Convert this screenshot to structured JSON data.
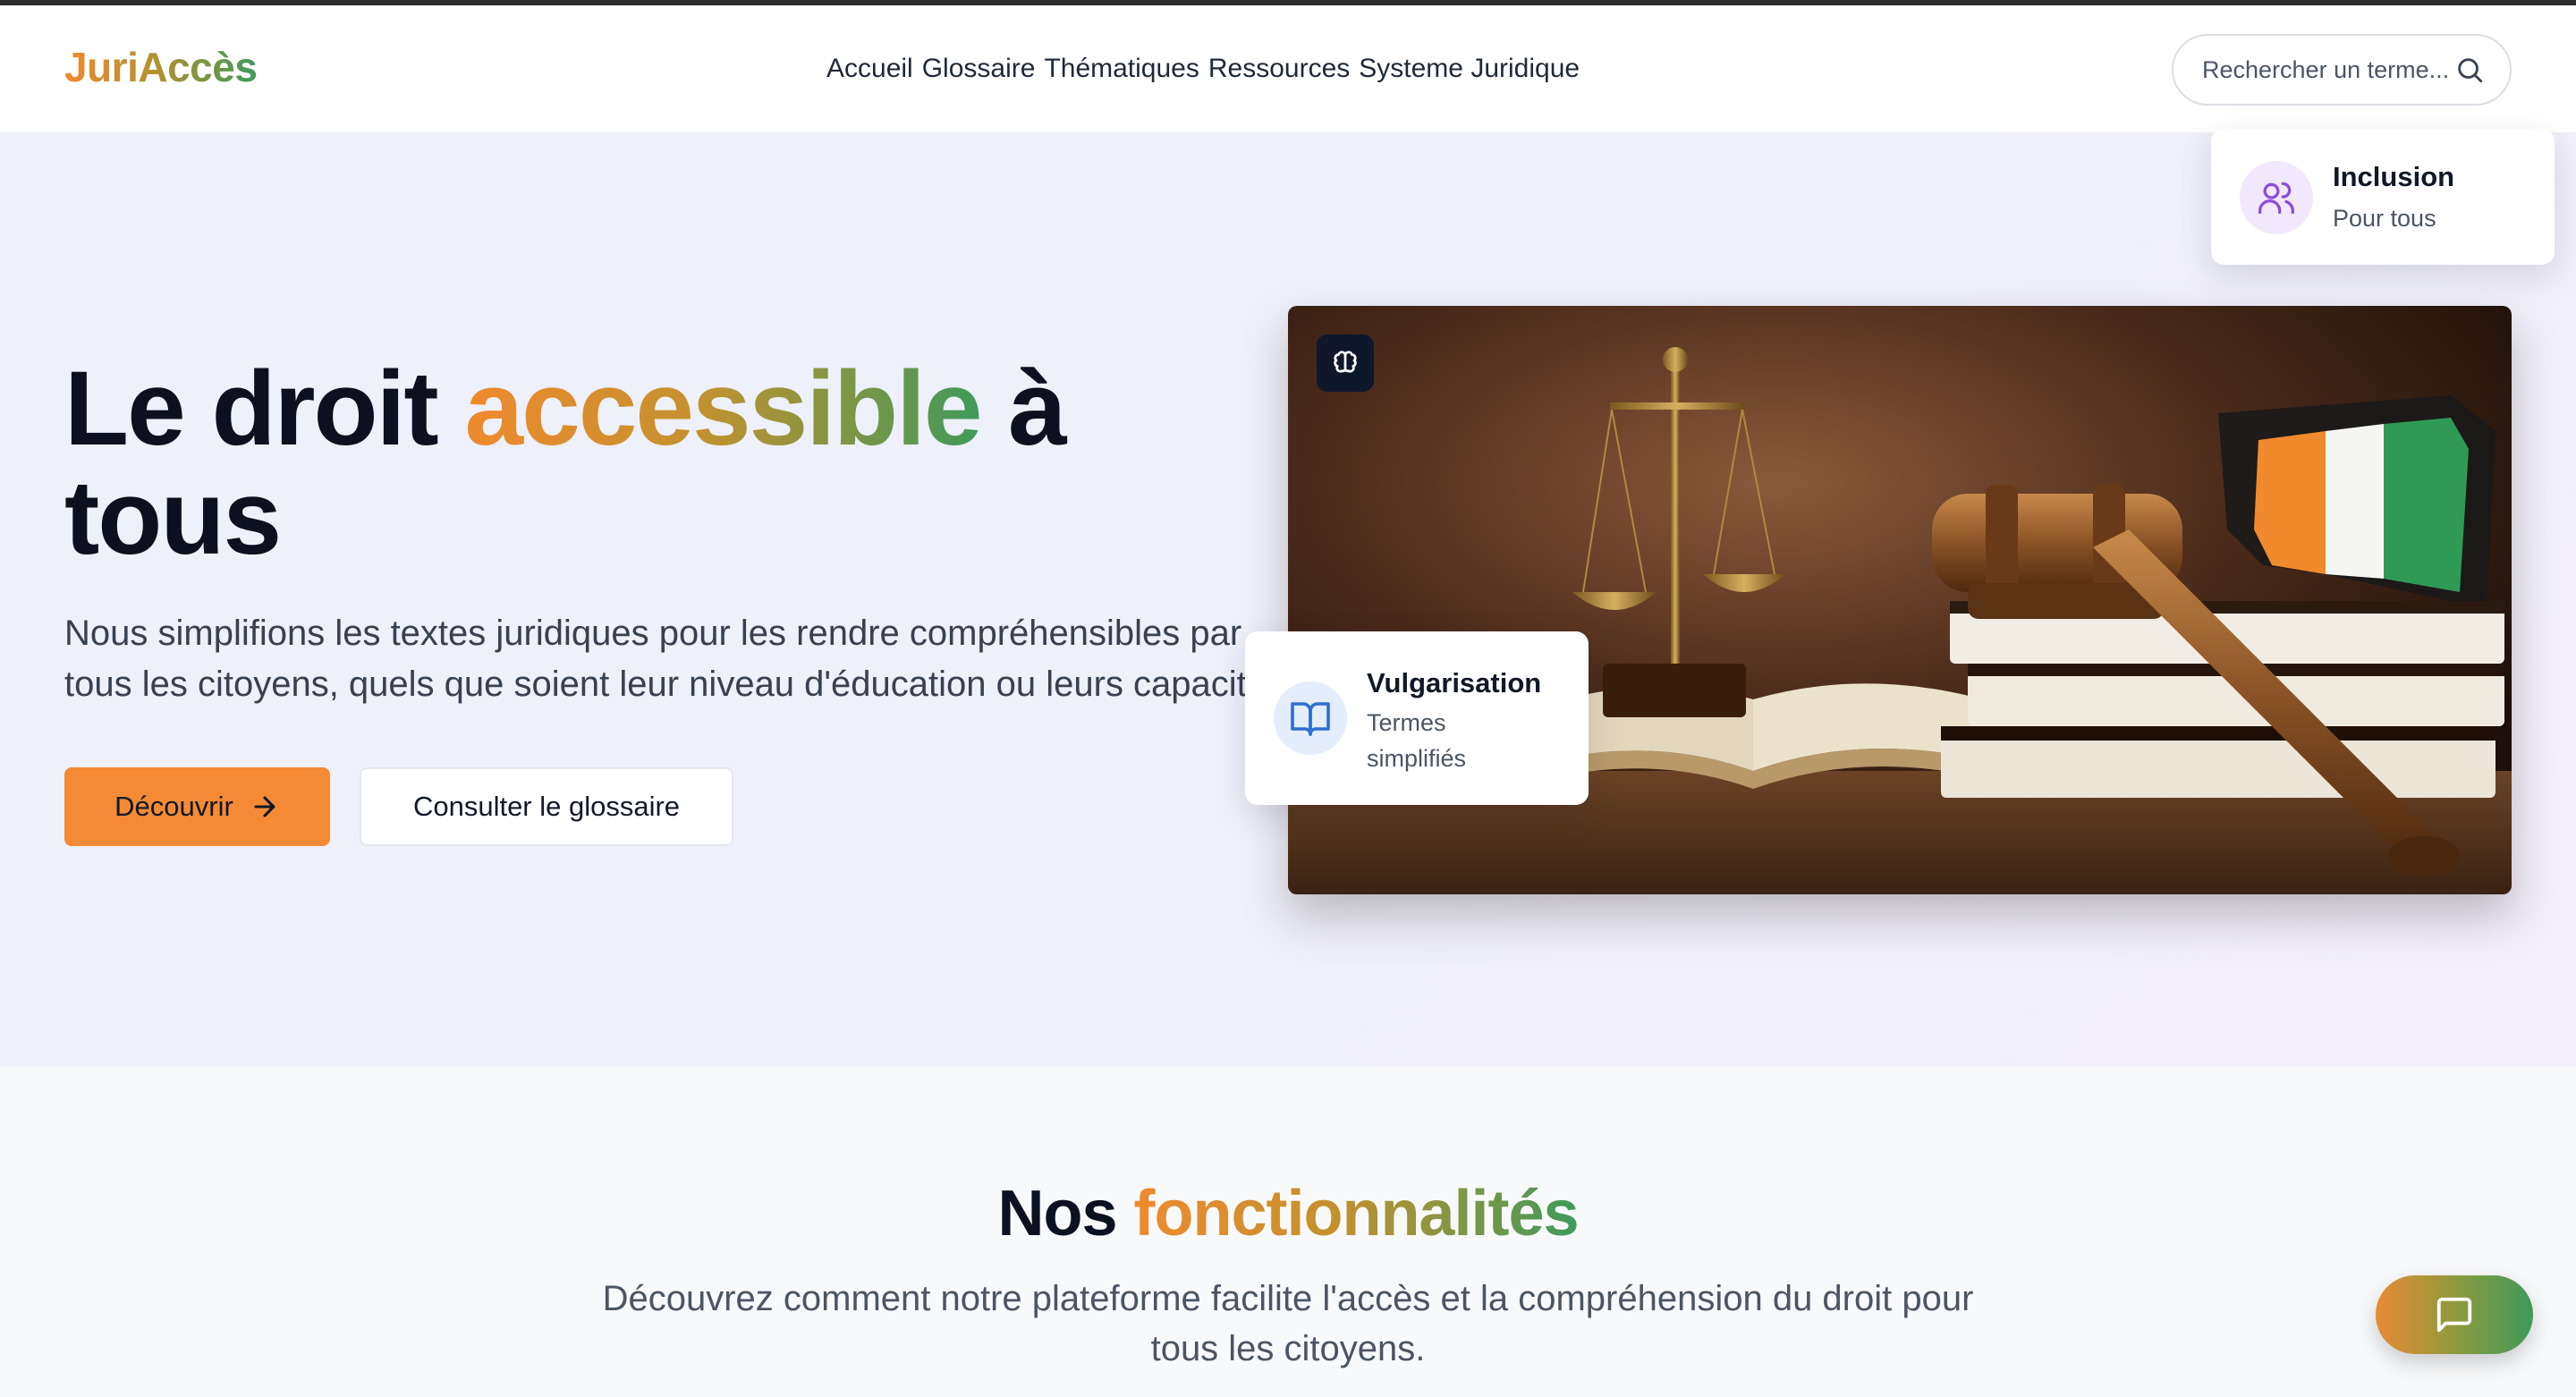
{
  "brand": {
    "name": "JuriAccès"
  },
  "nav": {
    "items": [
      {
        "label": "Accueil"
      },
      {
        "label": "Glossaire"
      },
      {
        "label": "Thématiques"
      },
      {
        "label": "Ressources"
      },
      {
        "label": "Systeme Juridique"
      }
    ]
  },
  "search": {
    "placeholder": "Rechercher un terme...",
    "icon": "search-icon"
  },
  "hero": {
    "title_part1": "Le droit",
    "title_highlight": "accessible",
    "title_part2": "à tous",
    "subtitle": "Nous simplifions les textes juridiques pour les rendre compréhensibles par tous les citoyens, quels que soient leur niveau d'éducation ou leurs capacités.",
    "primary_button": {
      "label": "Découvrir",
      "icon": "arrow-right-icon"
    },
    "secondary_button": {
      "label": "Consulter le glossaire"
    },
    "image_badge_icon": "brain-icon"
  },
  "cards": {
    "inclusion": {
      "title": "Inclusion",
      "subtitle": "Pour tous",
      "icon": "users-icon"
    },
    "vulgarisation": {
      "title": "Vulgarisation",
      "subtitle": "Termes simplifiés",
      "icon": "book-open-icon"
    }
  },
  "features": {
    "title_part1": "Nos",
    "title_highlight": "fonctionnalités",
    "subtitle": "Découvrez comment notre plateforme facilite l'accès et la compréhension du droit pour tous les citoyens."
  },
  "chat": {
    "icon": "message-square-icon"
  },
  "colors": {
    "accent_orange": "#f58a36",
    "accent_green": "#3f9a5a",
    "text_dark": "#0b1120",
    "text_muted": "#4b5563"
  }
}
